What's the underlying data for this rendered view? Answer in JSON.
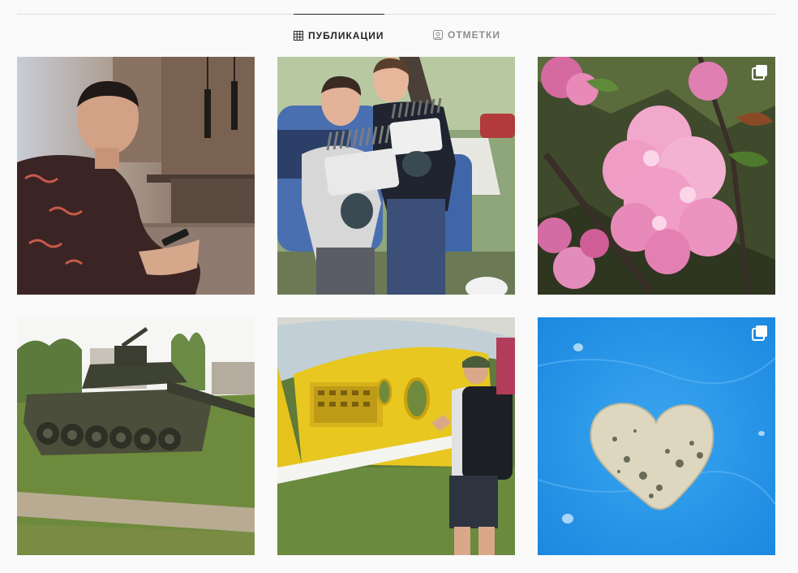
{
  "tabs": {
    "publications": {
      "label": "ПУБЛИКАЦИИ",
      "icon": "grid-icon",
      "active": true
    },
    "tagged": {
      "label": "ОТМЕТКИ",
      "icon": "tagged-user-icon",
      "active": false
    }
  },
  "posts": [
    {
      "subject": "young man seated at table holding phone",
      "multiple": false
    },
    {
      "subject": "two young men holding brushes outdoors",
      "multiple": false
    },
    {
      "subject": "pink blossom cluster",
      "multiple": true
    },
    {
      "subject": "tank monument on grass",
      "multiple": false
    },
    {
      "subject": "man with backpack under yellow canopy",
      "multiple": false
    },
    {
      "subject": "heart-shaped potato on blue background",
      "multiple": true
    }
  ],
  "colors": {
    "active_text": "#262626",
    "inactive_text": "#8e8e8e",
    "divider": "#dbdbdb",
    "background": "#fafafa"
  }
}
